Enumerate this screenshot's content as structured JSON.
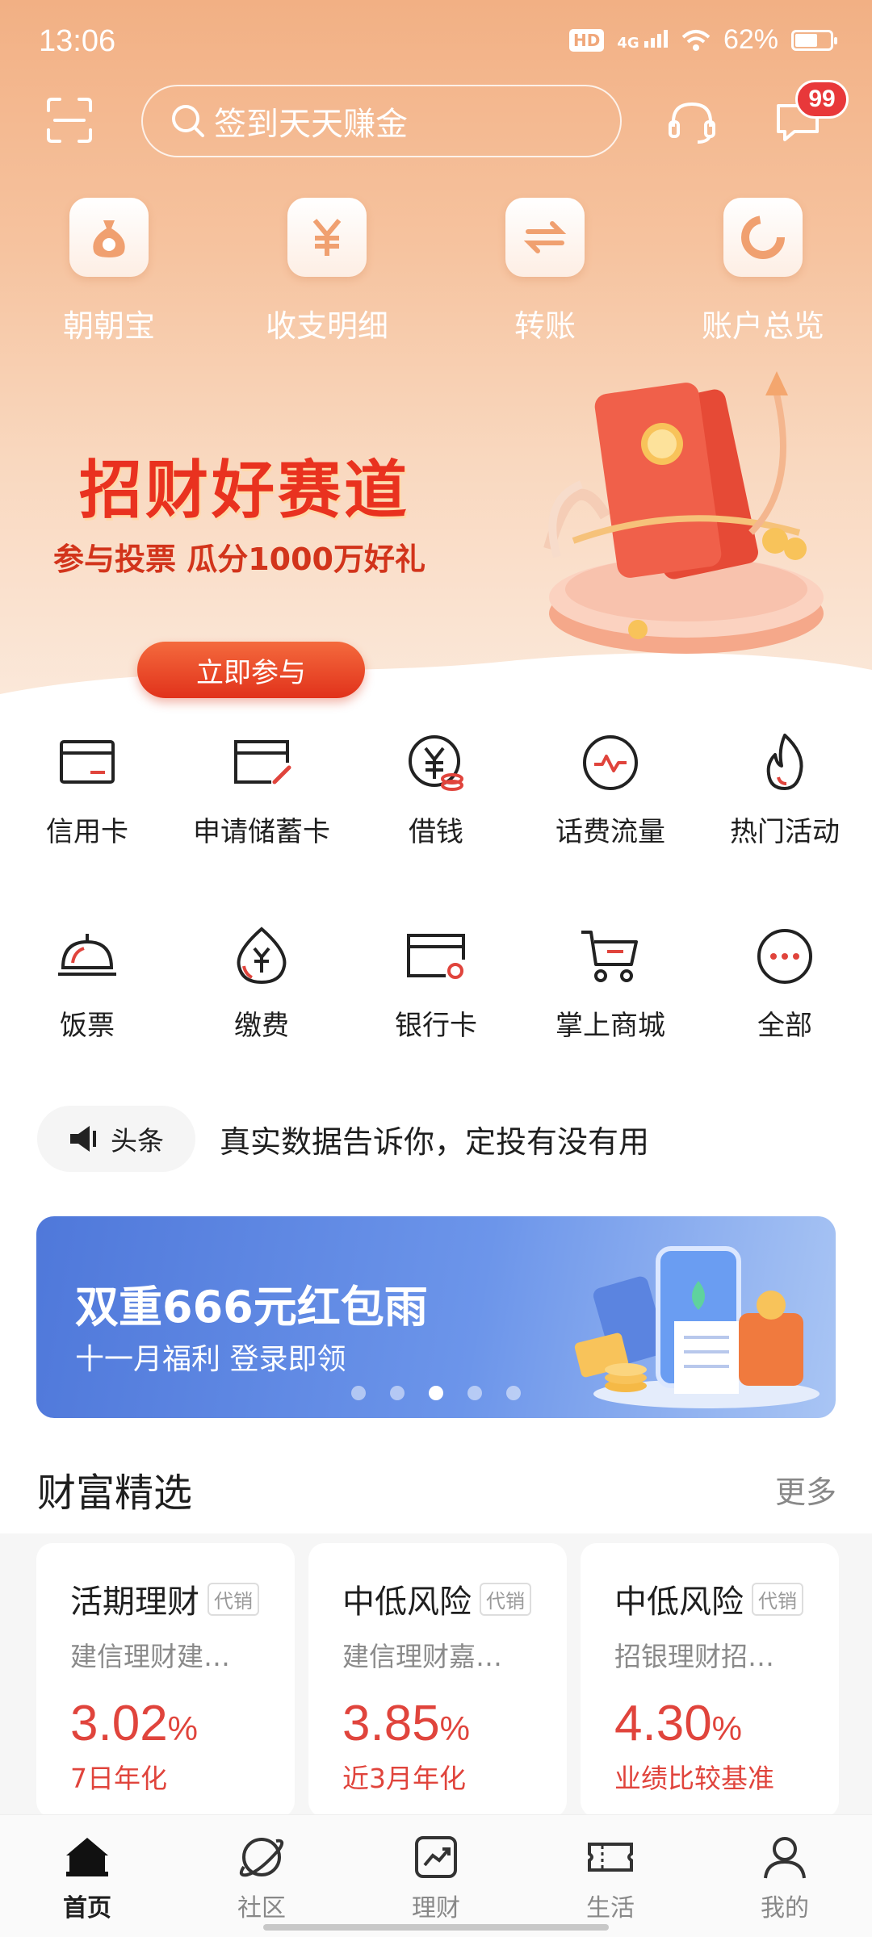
{
  "status_bar": {
    "time": "13:06",
    "hd": "HD",
    "network": "4G",
    "battery": "62%",
    "battery_level": 0.62
  },
  "header": {
    "search_placeholder": "签到天天赚金",
    "message_badge": "99"
  },
  "quick_actions": [
    {
      "label": "朝朝宝",
      "icon": "money-bag-icon"
    },
    {
      "label": "收支明细",
      "icon": "yuan-icon"
    },
    {
      "label": "转账",
      "icon": "transfer-icon"
    },
    {
      "label": "账户总览",
      "icon": "pie-chart-icon"
    }
  ],
  "promo": {
    "title": "招财好赛道",
    "subtitle": "参与投票 瓜分1000万好礼",
    "button": "立即参与"
  },
  "services_row1": [
    {
      "label": "信用卡",
      "icon": "credit-card-icon"
    },
    {
      "label": "申请储蓄卡",
      "icon": "apply-card-icon"
    },
    {
      "label": "借钱",
      "icon": "loan-icon"
    },
    {
      "label": "话费流量",
      "icon": "phone-bill-icon"
    },
    {
      "label": "热门活动",
      "icon": "flame-icon"
    }
  ],
  "services_row2": [
    {
      "label": "饭票",
      "icon": "meal-icon"
    },
    {
      "label": "缴费",
      "icon": "payment-icon"
    },
    {
      "label": "银行卡",
      "icon": "bank-card-icon"
    },
    {
      "label": "掌上商城",
      "icon": "cart-icon"
    },
    {
      "label": "全部",
      "icon": "more-icon"
    }
  ],
  "headline": {
    "tag": "头条",
    "text": "真实数据告诉你，定投有没有用"
  },
  "banner": {
    "title": "双重666元红包雨",
    "subtitle": "十一月福利 登录即领",
    "dots": 5,
    "active_dot": 3
  },
  "wealth": {
    "title": "财富精选",
    "more": "更多",
    "cards": [
      {
        "title": "活期理财",
        "tag": "代销",
        "name": "建信理财建…",
        "rate": "3.02",
        "pct": "%",
        "rate_label": "7日年化"
      },
      {
        "title": "中低风险",
        "tag": "代销",
        "name": "建信理财嘉…",
        "rate": "3.85",
        "pct": "%",
        "rate_label": "近3月年化"
      },
      {
        "title": "中低风险",
        "tag": "代销",
        "name": "招银理财招…",
        "rate": "4.30",
        "pct": "%",
        "rate_label": "业绩比较基准"
      }
    ]
  },
  "tabs": [
    {
      "label": "首页",
      "icon": "home-icon",
      "active": true
    },
    {
      "label": "社区",
      "icon": "planet-icon",
      "active": false
    },
    {
      "label": "理财",
      "icon": "chart-icon",
      "active": false
    },
    {
      "label": "生活",
      "icon": "ticket-icon",
      "active": false
    },
    {
      "label": "我的",
      "icon": "profile-icon",
      "active": false
    }
  ],
  "colors": {
    "accent": "#e0443c",
    "hero_top": "#f2b084",
    "banner_blue": "#4f78da",
    "badge_red": "#e8383a"
  }
}
